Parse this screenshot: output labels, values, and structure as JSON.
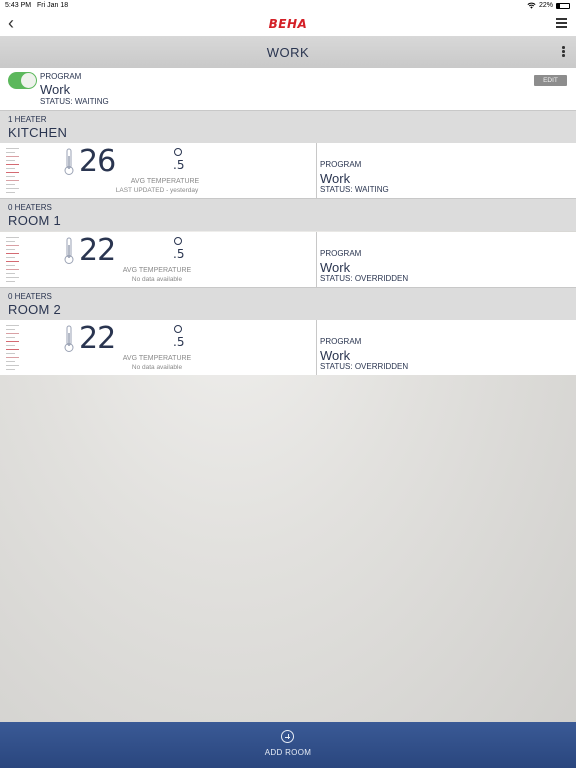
{
  "status_bar": {
    "time": "5:43 PM",
    "date": "Fri Jan 18",
    "battery": "22%",
    "battery_level": 0.22
  },
  "nav": {
    "logo": "BEHA"
  },
  "title_bar": {
    "title": "WORK"
  },
  "program_panel": {
    "enabled": true,
    "label": "PROGRAM",
    "name": "Work",
    "status": "STATUS: WAITING",
    "edit_label": "EDIT"
  },
  "rooms": [
    {
      "heater_count": "1 HEATER",
      "name": "KITCHEN",
      "temp_whole": "26",
      "temp_decimal": ".5",
      "temp_label": "AVG TEMPERATURE",
      "temp_sub": "LAST UPDATED - yesterday",
      "program_label": "PROGRAM",
      "program_name": "Work",
      "program_status": "STATUS: WAITING"
    },
    {
      "heater_count": "0 HEATERS",
      "name": "ROOM 1",
      "temp_whole": "22",
      "temp_decimal": ".5",
      "temp_label": "AVG TEMPERATURE",
      "temp_sub": "No data available",
      "program_label": "PROGRAM",
      "program_name": "Work",
      "program_status": "STATUS: OVERRIDDEN"
    },
    {
      "heater_count": "0 HEATERS",
      "name": "ROOM 2",
      "temp_whole": "22",
      "temp_decimal": ".5",
      "temp_label": "AVG TEMPERATURE",
      "temp_sub": "No data available",
      "program_label": "PROGRAM",
      "program_name": "Work",
      "program_status": "STATUS: OVERRIDDEN"
    }
  ],
  "bottom_bar": {
    "add_label": "ADD ROOM"
  },
  "colors": {
    "accent": "#2a467e",
    "toggle_on": "#5cb85c",
    "logo": "#d42027"
  }
}
